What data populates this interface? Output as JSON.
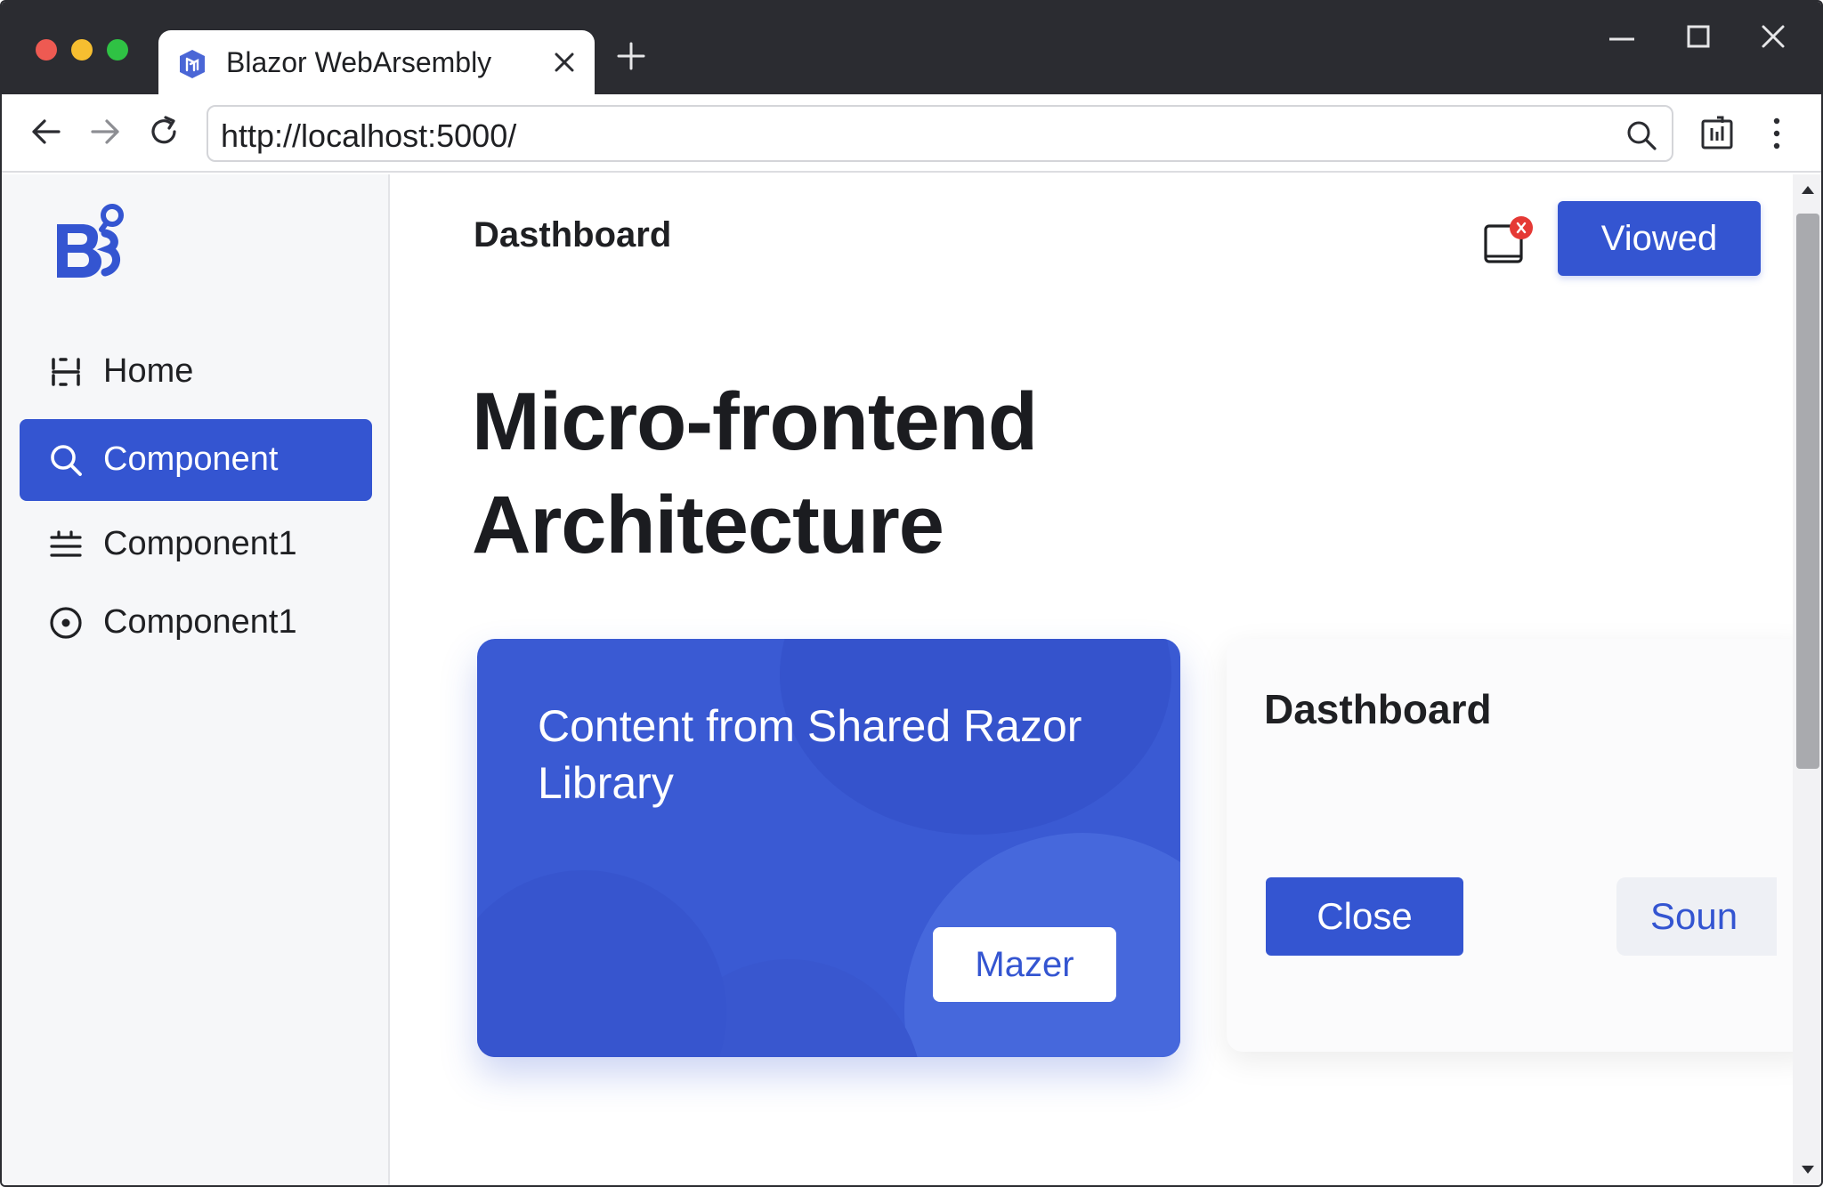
{
  "browser": {
    "tab_title": "Blazor WebArsembly",
    "url": "http://localhost:5000/"
  },
  "sidebar": {
    "items": [
      {
        "label": "Home",
        "icon": "home-icon"
      },
      {
        "label": "Component",
        "icon": "search-icon",
        "active": true
      },
      {
        "label": "Component1",
        "icon": "list-icon"
      },
      {
        "label": "Component1",
        "icon": "target-icon"
      }
    ]
  },
  "header": {
    "title": "Dasthboard",
    "button_label": "Viowed"
  },
  "hero": {
    "line1": "Micro-frontend",
    "line2": "Architecture"
  },
  "card_blue": {
    "text": "Content from Shared Razor Library",
    "button_label": "Mazer"
  },
  "card_white": {
    "title": "Dasthboard",
    "close_label": "Close",
    "secondary_label": "Soun"
  },
  "colors": {
    "accent": "#3455d1",
    "titlebar": "#2b2c31",
    "notification": "#e53935"
  }
}
